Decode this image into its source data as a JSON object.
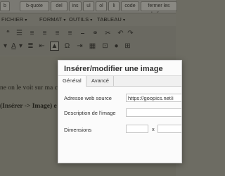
{
  "quicktags": [
    "b",
    "b-quote",
    "del",
    "ins",
    "ul",
    "ol",
    "li",
    "code",
    "fermer les balises"
  ],
  "menubar": [
    {
      "label": "FICHIER"
    },
    {
      "label": "FORMAT"
    },
    {
      "label": "OUTILS"
    },
    {
      "label": "TABLEAU"
    }
  ],
  "toolbar": {
    "row1_icons": [
      "quote-icon",
      "bulleted-list-icon",
      "numbered-list-icon",
      "align-left-icon",
      "align-center-icon",
      "align-right-icon",
      "link-icon",
      "unlink-icon",
      "undo-icon",
      "redo-icon"
    ],
    "row2_icons": [
      "text-color-icon",
      "align-justify-icon",
      "outdent-icon",
      "indent-icon",
      "image-icon",
      "special-char-icon",
      "horizontal-rule-icon",
      "media-icon",
      "code-icon",
      "help-icon"
    ]
  },
  "document": {
    "line1": "ne on le voit sur ma c",
    "line2_bold": "(Insérer -> Image) e"
  },
  "dialog": {
    "title": "Insérer/modifier une image",
    "tabs": [
      "Général",
      "Avancé"
    ],
    "source_label": "Adresse web source",
    "source_value": "https://goopics.net/i",
    "description_label": "Description de l'image",
    "description_value": "",
    "dimensions_label": "Dimensions",
    "width_value": "",
    "height_value": "",
    "dimensions_separator": "x"
  }
}
